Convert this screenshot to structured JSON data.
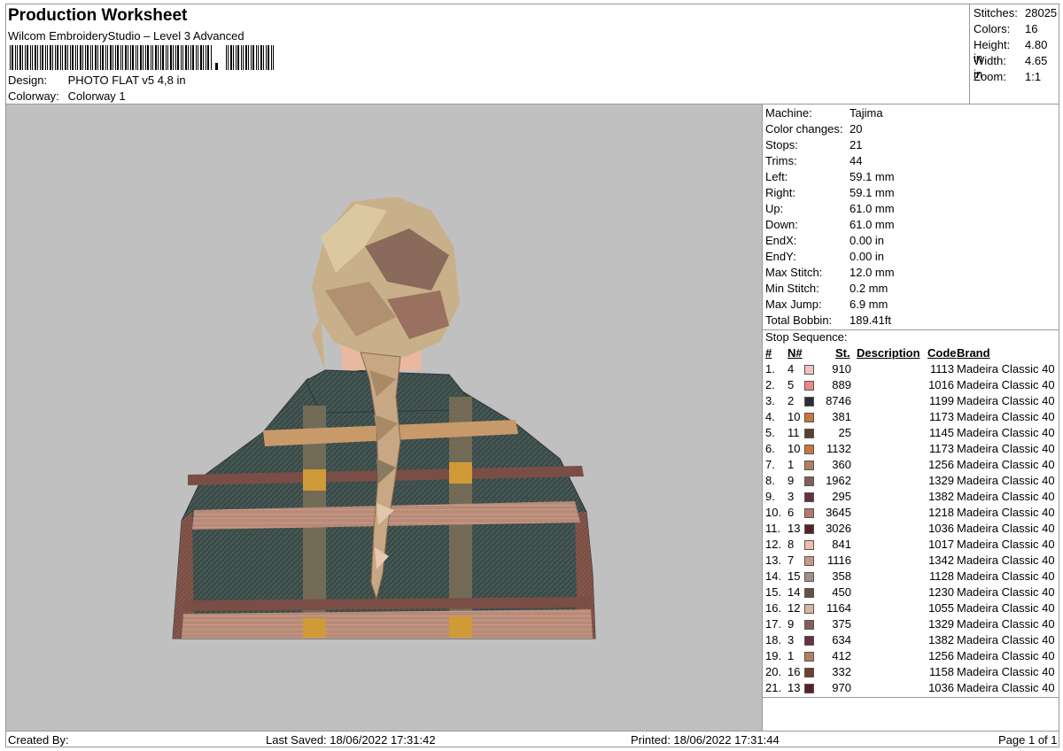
{
  "header": {
    "title": "Production Worksheet",
    "software": "Wilcom EmbroideryStudio – Level 3 Advanced",
    "design_label": "Design:",
    "design_value": "PHOTO FLAT v5 4,8 in",
    "colorway_label": "Colorway:",
    "colorway_value": "Colorway 1"
  },
  "stats": [
    {
      "label": "Stitches:",
      "value": "28025"
    },
    {
      "label": "Colors:",
      "value": "16"
    },
    {
      "label": "Height:",
      "value": "4.80 in"
    },
    {
      "label": "Width:",
      "value": "4.65 in"
    },
    {
      "label": "Zoom:",
      "value": "1:1"
    }
  ],
  "machine": [
    {
      "label": "Machine:",
      "value": "Tajima"
    },
    {
      "label": "Color changes:",
      "value": "20"
    },
    {
      "label": "Stops:",
      "value": "21"
    },
    {
      "label": "Trims:",
      "value": "44"
    },
    {
      "label": "Left:",
      "value": "59.1 mm"
    },
    {
      "label": "Right:",
      "value": "59.1 mm"
    },
    {
      "label": "Up:",
      "value": "61.0 mm"
    },
    {
      "label": "Down:",
      "value": "61.0 mm"
    },
    {
      "label": "EndX:",
      "value": "0.00 in"
    },
    {
      "label": "EndY:",
      "value": "0.00 in"
    },
    {
      "label": "Max Stitch:",
      "value": "12.0 mm"
    },
    {
      "label": "Min Stitch:",
      "value": "0.2 mm"
    },
    {
      "label": "Max Jump:",
      "value": "6.9 mm"
    },
    {
      "label": "Total Bobbin:",
      "value": "189.41ft"
    }
  ],
  "stop_sequence": {
    "title": "Stop Sequence:",
    "columns": {
      "idx": "#",
      "n": "N#",
      "st": "St.",
      "desc": "Description",
      "code": "Code",
      "brand": "Brand"
    },
    "rows": [
      {
        "idx": "1.",
        "n": "4",
        "color": "#f2c0c0",
        "st": "910",
        "code": "1113",
        "brand": "Madeira Classic 40"
      },
      {
        "idx": "2.",
        "n": "5",
        "color": "#e88a84",
        "st": "889",
        "code": "1016",
        "brand": "Madeira Classic 40"
      },
      {
        "idx": "3.",
        "n": "2",
        "color": "#2a3038",
        "st": "8746",
        "code": "1199",
        "brand": "Madeira Classic 40"
      },
      {
        "idx": "4.",
        "n": "10",
        "color": "#c8783c",
        "st": "381",
        "code": "1173",
        "brand": "Madeira Classic 40"
      },
      {
        "idx": "5.",
        "n": "11",
        "color": "#5a4030",
        "st": "25",
        "code": "1145",
        "brand": "Madeira Classic 40"
      },
      {
        "idx": "6.",
        "n": "10",
        "color": "#c8783c",
        "st": "1132",
        "code": "1173",
        "brand": "Madeira Classic 40"
      },
      {
        "idx": "7.",
        "n": "1",
        "color": "#b08060",
        "st": "360",
        "code": "1256",
        "brand": "Madeira Classic 40"
      },
      {
        "idx": "8.",
        "n": "9",
        "color": "#806058",
        "st": "1962",
        "code": "1329",
        "brand": "Madeira Classic 40"
      },
      {
        "idx": "9.",
        "n": "3",
        "color": "#6a3040",
        "st": "295",
        "code": "1382",
        "brand": "Madeira Classic 40"
      },
      {
        "idx": "10.",
        "n": "6",
        "color": "#b87870",
        "st": "3645",
        "code": "1218",
        "brand": "Madeira Classic 40"
      },
      {
        "idx": "11.",
        "n": "13",
        "color": "#5a2028",
        "st": "3026",
        "code": "1036",
        "brand": "Madeira Classic 40"
      },
      {
        "idx": "12.",
        "n": "8",
        "color": "#f2bca8",
        "st": "841",
        "code": "1017",
        "brand": "Madeira Classic 40"
      },
      {
        "idx": "13.",
        "n": "7",
        "color": "#c89888",
        "st": "1116",
        "code": "1342",
        "brand": "Madeira Classic 40"
      },
      {
        "idx": "14.",
        "n": "15",
        "color": "#a09088",
        "st": "358",
        "code": "1128",
        "brand": "Madeira Classic 40"
      },
      {
        "idx": "15.",
        "n": "14",
        "color": "#6a5040",
        "st": "450",
        "code": "1230",
        "brand": "Madeira Classic 40"
      },
      {
        "idx": "16.",
        "n": "12",
        "color": "#d8b898",
        "st": "1164",
        "code": "1055",
        "brand": "Madeira Classic 40"
      },
      {
        "idx": "17.",
        "n": "9",
        "color": "#806058",
        "st": "375",
        "code": "1329",
        "brand": "Madeira Classic 40"
      },
      {
        "idx": "18.",
        "n": "3",
        "color": "#6a3040",
        "st": "634",
        "code": "1382",
        "brand": "Madeira Classic 40"
      },
      {
        "idx": "19.",
        "n": "1",
        "color": "#b08060",
        "st": "412",
        "code": "1256",
        "brand": "Madeira Classic 40"
      },
      {
        "idx": "20.",
        "n": "16",
        "color": "#704030",
        "st": "332",
        "code": "1158",
        "brand": "Madeira Classic 40"
      },
      {
        "idx": "21.",
        "n": "13",
        "color": "#5a2028",
        "st": "970",
        "code": "1036",
        "brand": "Madeira Classic 40"
      }
    ]
  },
  "footer": {
    "created_by": "Created By:",
    "last_saved": "Last Saved: 18/06/2022 17:31:42",
    "printed": "Printed: 18/06/2022 17:31:44",
    "page": "Page 1 of 1"
  }
}
